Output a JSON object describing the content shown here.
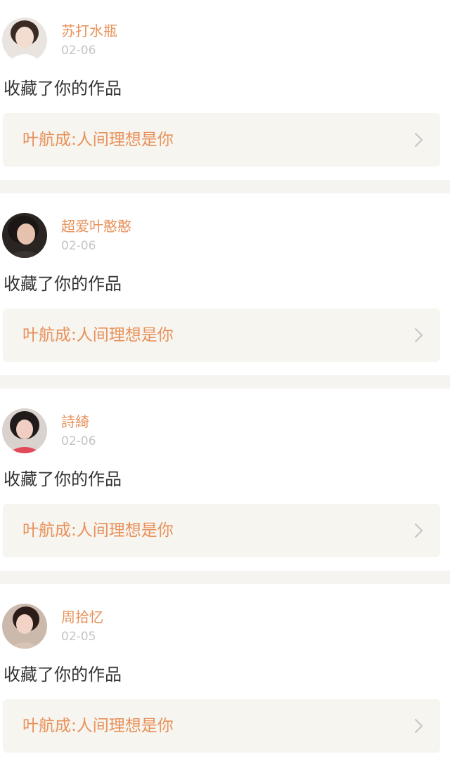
{
  "feed": {
    "entries": [
      {
        "username": "苏打水瓶",
        "date": "02-06",
        "action": "收藏了你的作品",
        "work_title": "叶航成:人间理想是你",
        "avatar": {
          "bg": "#e9e4df",
          "hair": "#3a2a24",
          "skin": "#f3ddd0",
          "shirt": "#ffffff"
        }
      },
      {
        "username": "超爱叶憨憨",
        "date": "02-06",
        "action": "收藏了你的作品",
        "work_title": "叶航成:人间理想是你",
        "avatar": {
          "bg": "#2a2522",
          "hair": "#1c1714",
          "skin": "#e6c2ae",
          "shirt": "#3b3330"
        }
      },
      {
        "username": "詩綺",
        "date": "02-06",
        "action": "收藏了你的作品",
        "work_title": "叶航成:人间理想是你",
        "avatar": {
          "bg": "#d9d2cf",
          "hair": "#201a1a",
          "skin": "#f0cfc2",
          "shirt": "#e24a5a"
        }
      },
      {
        "username": "周拾忆",
        "date": "02-05",
        "action": "收藏了你的作品",
        "work_title": "叶航成:人间理想是你",
        "avatar": {
          "bg": "#cbb9ac",
          "hair": "#2b1c17",
          "skin": "#f2d3c6",
          "shirt": "#d8c3b6"
        }
      }
    ]
  },
  "colors": {
    "accent": "#e8915b",
    "date_gray": "#c4c4c4",
    "card_bg": "#f7f5ef",
    "divider_bg": "#f6f4f0",
    "chevron": "#c7c7c7"
  }
}
